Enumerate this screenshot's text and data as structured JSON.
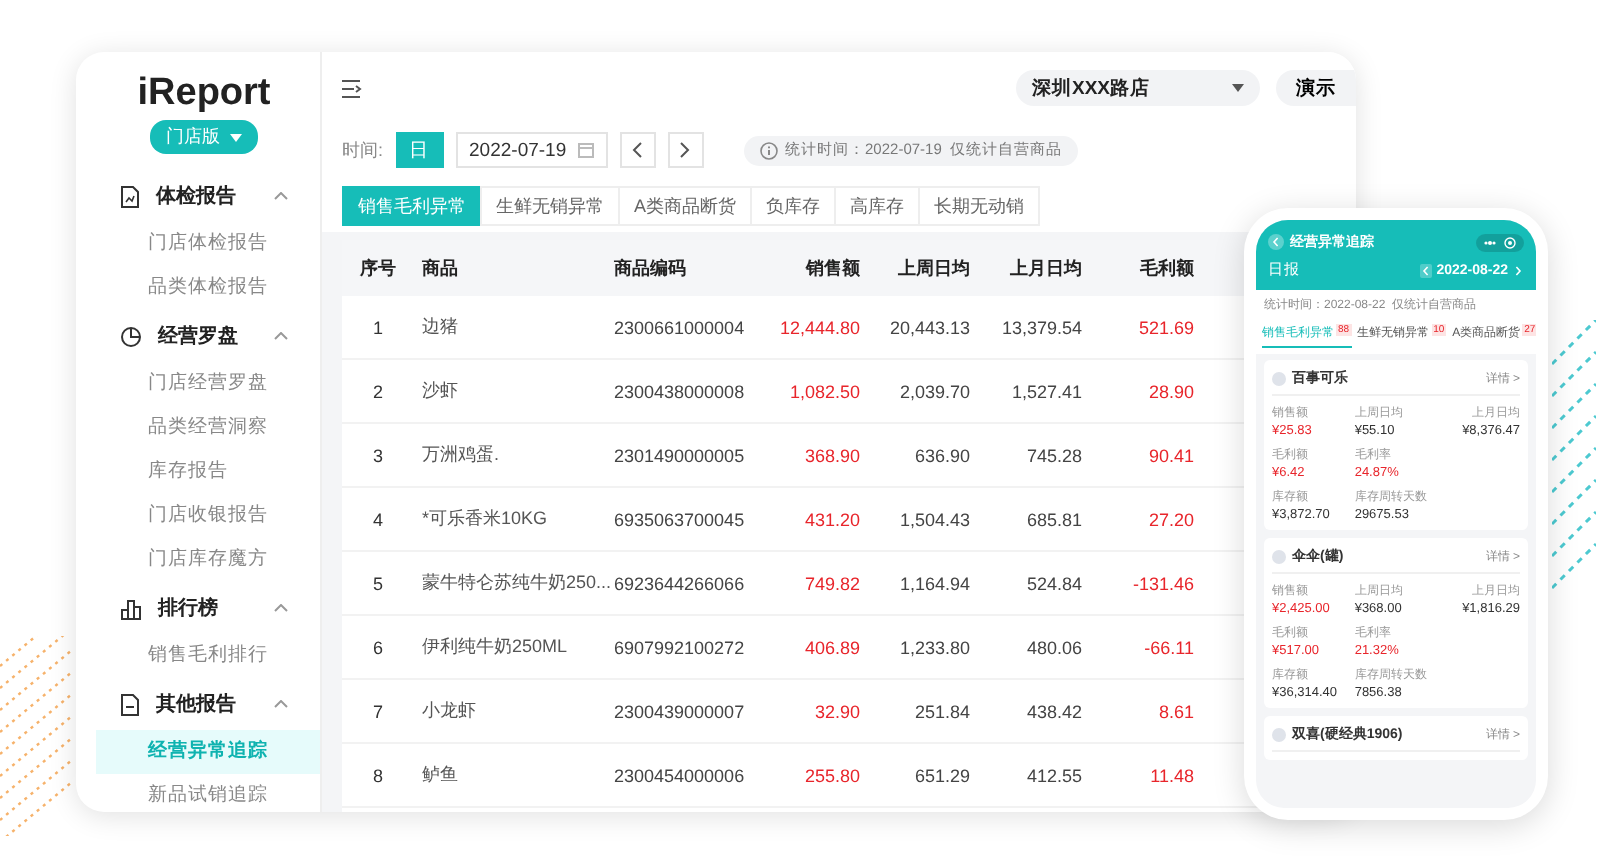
{
  "sidebar": {
    "logo": "iReport",
    "edition": "门店版",
    "groups": [
      {
        "title": "体检报告",
        "expanded": true,
        "items": [
          {
            "label": "门店体检报告",
            "selected": false
          },
          {
            "label": "品类体检报告",
            "selected": false
          }
        ]
      },
      {
        "title": "经营罗盘",
        "expanded": true,
        "items": [
          {
            "label": "门店经营罗盘",
            "selected": false
          },
          {
            "label": "品类经营洞察",
            "selected": false
          },
          {
            "label": "库存报告",
            "selected": false
          },
          {
            "label": "门店收银报告",
            "selected": false
          },
          {
            "label": "门店库存魔方",
            "selected": false
          }
        ]
      },
      {
        "title": "排行榜",
        "expanded": true,
        "items": [
          {
            "label": "销售毛利排行",
            "selected": false
          }
        ]
      },
      {
        "title": "其他报告",
        "expanded": true,
        "items": [
          {
            "label": "经营异常追踪",
            "selected": true
          },
          {
            "label": "新品试销追踪",
            "selected": false
          }
        ]
      }
    ]
  },
  "toolbar": {
    "store": "深圳XXX路店",
    "demo": "演示"
  },
  "filter": {
    "label": "时间:",
    "period": "日",
    "date": "2022-07-19",
    "info": "统计时间：2022-07-19  仅统计自营商品"
  },
  "tabs": [
    {
      "label": "销售毛利异常",
      "selected": true
    },
    {
      "label": "生鲜无销异常",
      "selected": false
    },
    {
      "label": "A类商品断货",
      "selected": false
    },
    {
      "label": "负库存",
      "selected": false
    },
    {
      "label": "高库存",
      "selected": false
    },
    {
      "label": "长期无动销",
      "selected": false
    }
  ],
  "table": {
    "columns": [
      {
        "label": "序号",
        "color": "#333333"
      },
      {
        "label": "商品",
        "color": "#555555"
      },
      {
        "label": "商品编码",
        "color": "#444444"
      },
      {
        "label": "销售额",
        "color": "#e8252b"
      },
      {
        "label": "上周日均",
        "color": "#444444"
      },
      {
        "label": "上月日均",
        "color": "#444444"
      },
      {
        "label": "毛利额",
        "color": "#e8252b"
      }
    ],
    "rows": [
      [
        "1",
        "边猪",
        "2300661000004",
        "12,444.80",
        "20,443.13",
        "13,379.54",
        "521.69"
      ],
      [
        "2",
        "沙虾",
        "2300438000008",
        "1,082.50",
        "2,039.70",
        "1,527.41",
        "28.90"
      ],
      [
        "3",
        "万洲鸡蛋.",
        "2301490000005",
        "368.90",
        "636.90",
        "745.28",
        "90.41"
      ],
      [
        "4",
        "*可乐香米10KG",
        "6935063700045",
        "431.20",
        "1,504.43",
        "685.81",
        "27.20"
      ],
      [
        "5",
        "蒙牛特仑苏纯牛奶250...",
        "6923644266066",
        "749.82",
        "1,164.94",
        "524.84",
        "-131.46"
      ],
      [
        "6",
        "伊利纯牛奶250ML",
        "6907992100272",
        "406.89",
        "1,233.80",
        "480.06",
        "-66.11"
      ],
      [
        "7",
        "小龙虾",
        "2300439000007",
        "32.90",
        "251.84",
        "438.42",
        "8.61"
      ],
      [
        "8",
        "鲈鱼",
        "2300454000006",
        "255.80",
        "651.29",
        "412.55",
        "11.48"
      ]
    ]
  },
  "phone": {
    "title": "经营异常追踪",
    "period": "日报",
    "date": "2022-08-22",
    "info": "统计时间：2022-08-22  仅统计自营商品",
    "tabs": [
      {
        "label": "销售毛利异常",
        "badge": "88",
        "selected": true
      },
      {
        "label": "生鲜无销异常",
        "badge": "10",
        "selected": false
      },
      {
        "label": "A类商品断货",
        "badge": "27",
        "selected": false
      }
    ],
    "cards": [
      {
        "name": "百事可乐",
        "link": "详情 >",
        "fields": [
          {
            "label": "销售额",
            "value": "¥25.83",
            "alert": true
          },
          {
            "label": "上周日均",
            "value": "¥55.10",
            "alert": false
          },
          {
            "label": "上月日均",
            "value": "¥8,376.47",
            "alert": false
          },
          {
            "label": "毛利额",
            "value": "¥6.42",
            "alert": true
          },
          {
            "label": "毛利率",
            "value": "24.87%",
            "alert": true
          },
          {
            "label": "库存额",
            "value": "¥3,872.70",
            "alert": false
          },
          {
            "label": "库存周转天数",
            "value": "29675.53",
            "alert": false
          }
        ]
      },
      {
        "name": "伞伞(罐)",
        "link": "详情 >",
        "fields": [
          {
            "label": "销售额",
            "value": "¥2,425.00",
            "alert": true
          },
          {
            "label": "上周日均",
            "value": "¥368.00",
            "alert": false
          },
          {
            "label": "上月日均",
            "value": "¥1,816.29",
            "alert": false
          },
          {
            "label": "毛利额",
            "value": "¥517.00",
            "alert": true
          },
          {
            "label": "毛利率",
            "value": "21.32%",
            "alert": true
          },
          {
            "label": "库存额",
            "value": "¥36,314.40",
            "alert": false
          },
          {
            "label": "库存周转天数",
            "value": "7856.38",
            "alert": false
          }
        ]
      },
      {
        "name": "双喜(硬经典1906)",
        "link": "详情 >"
      }
    ]
  }
}
